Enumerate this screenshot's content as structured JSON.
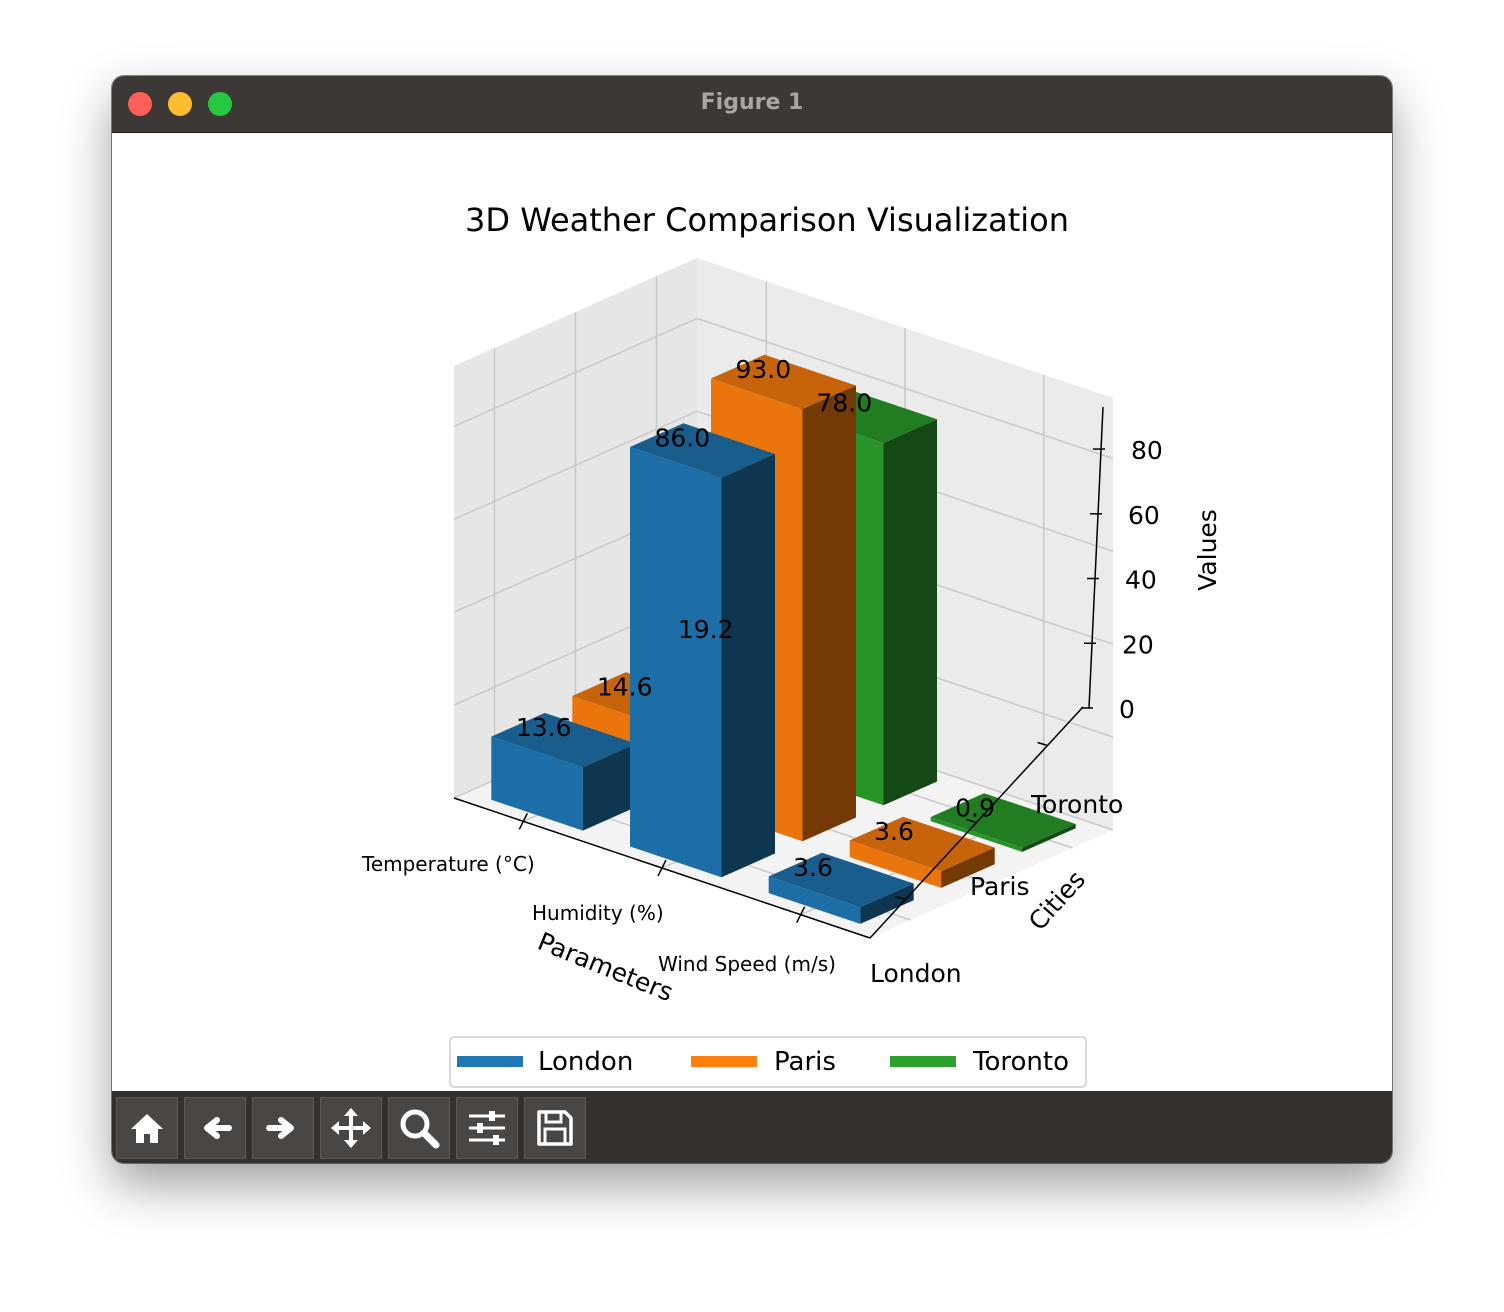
{
  "window": {
    "title": "Figure 1"
  },
  "toolbar": {
    "buttons": [
      {
        "name": "home-button",
        "icon": "home-icon"
      },
      {
        "name": "back-button",
        "icon": "arrow-left-icon"
      },
      {
        "name": "forward-button",
        "icon": "arrow-right-icon"
      },
      {
        "name": "pan-button",
        "icon": "move-icon"
      },
      {
        "name": "zoom-button",
        "icon": "magnifier-icon"
      },
      {
        "name": "configure-subplots-button",
        "icon": "sliders-icon"
      },
      {
        "name": "save-button",
        "icon": "floppy-disk-icon"
      }
    ]
  },
  "chart_data": {
    "type": "bar3d",
    "title": "3D Weather Comparison Visualization",
    "xlabel": "Parameters",
    "ylabel": "Cities",
    "zlabel": "Values",
    "x_categories": [
      "Temperature (°C)",
      "Humidity (%)",
      "Wind Speed (m/s)"
    ],
    "y_categories": [
      "London",
      "Paris",
      "Toronto"
    ],
    "z_ticks": [
      0,
      20,
      40,
      60,
      80
    ],
    "zlim": [
      0,
      93
    ],
    "grid": true,
    "legend": {
      "placement": "bottom-center",
      "entries": [
        "London",
        "Paris",
        "Toronto"
      ]
    },
    "colors": {
      "London": "#1f77b4",
      "Paris": "#ff7f0e",
      "Toronto": "#2ca02c"
    },
    "series": [
      {
        "name": "London",
        "values": [
          13.6,
          86.0,
          3.6
        ],
        "labels": [
          "13.6",
          "86.0",
          "3.6"
        ]
      },
      {
        "name": "Paris",
        "values": [
          14.6,
          93.0,
          3.6
        ],
        "labels": [
          "14.6",
          "93.0",
          "3.6"
        ]
      },
      {
        "name": "Toronto",
        "values": [
          19.2,
          78.0,
          0.9
        ],
        "labels": [
          "19.2",
          "78.0",
          "0.9"
        ]
      }
    ]
  }
}
